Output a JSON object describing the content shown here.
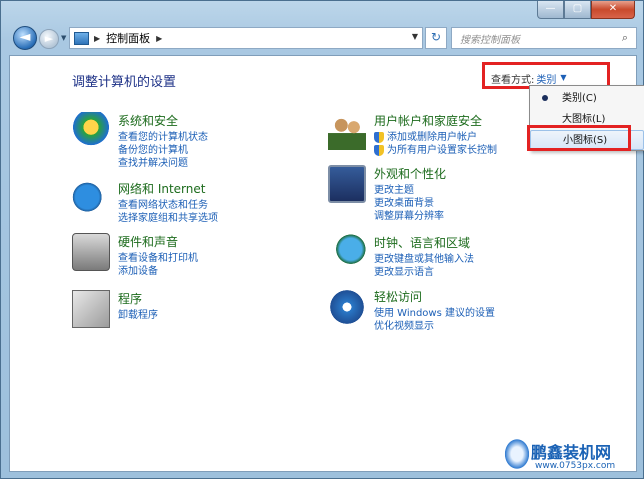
{
  "window": {
    "minimize_glyph": "—",
    "maximize_glyph": "▢",
    "close_glyph": "✕"
  },
  "nav": {
    "back_glyph": "◄",
    "forward_glyph": "►",
    "path_arrow": "▶",
    "breadcrumb": "控制面板",
    "breadcrumb_arrow": "▶",
    "refresh_glyph": "↻",
    "search_placeholder": "搜索控制面板",
    "search_glyph": "⌕"
  },
  "main": {
    "heading": "调整计算机的设置",
    "view_by_label": "查看方式:",
    "view_by_value": "类别",
    "view_by_caret": "▼"
  },
  "categories": [
    {
      "title": "系统和安全",
      "links": [
        "查看您的计算机状态",
        "备份您的计算机",
        "查找并解决问题"
      ]
    },
    {
      "title": "网络和 Internet",
      "links": [
        "查看网络状态和任务",
        "选择家庭组和共享选项"
      ]
    },
    {
      "title": "硬件和声音",
      "links": [
        "查看设备和打印机",
        "添加设备"
      ]
    },
    {
      "title": "程序",
      "links": [
        "卸载程序"
      ]
    },
    {
      "title": "用户帐户和家庭安全",
      "links": [
        "添加或删除用户帐户",
        "为所有用户设置家长控制"
      ]
    },
    {
      "title": "外观和个性化",
      "links": [
        "更改主题",
        "更改桌面背景",
        "调整屏幕分辨率"
      ]
    },
    {
      "title": "时钟、语言和区域",
      "links": [
        "更改键盘或其他输入法",
        "更改显示语言"
      ]
    },
    {
      "title": "轻松访问",
      "links": [
        "使用 Windows 建议的设置",
        "优化视频显示"
      ]
    }
  ],
  "menu": {
    "items": [
      "类别(C)",
      "大图标(L)",
      "小图标(S)"
    ]
  },
  "watermark": {
    "brand": "鹏鑫装机网",
    "url": "www.0753px.com"
  },
  "colors": {
    "link": "#1c5fb6",
    "category_title": "#1c6b1c",
    "heading": "#1e3287",
    "highlight_box": "#e32222"
  }
}
